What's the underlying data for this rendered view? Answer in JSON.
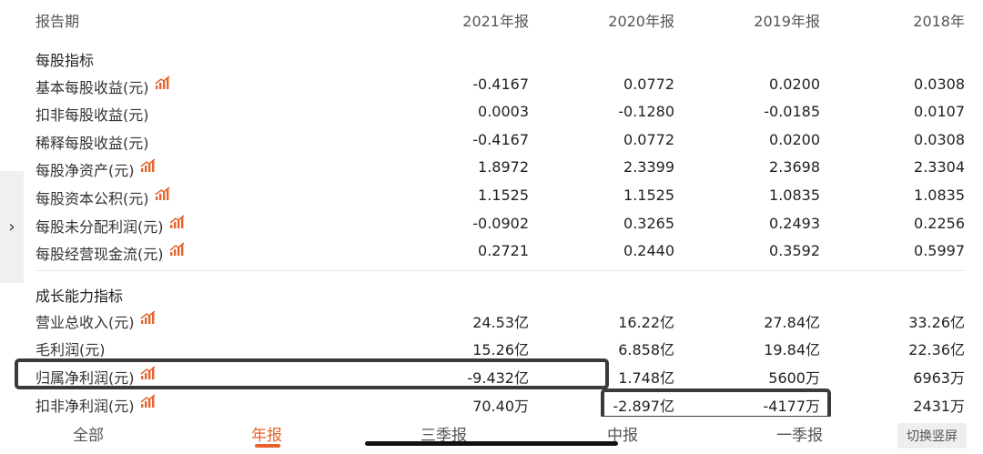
{
  "header": {
    "label": "报告期",
    "periods": [
      "2021年报",
      "2020年报",
      "2019年报",
      "2018年"
    ]
  },
  "side_tab": {
    "chevron": "›"
  },
  "sections": [
    {
      "title": "每股指标",
      "rows": [
        {
          "label": "基本每股收益(元)",
          "trend_icon": true,
          "values": [
            "-0.4167",
            "0.0772",
            "0.0200",
            "0.0308"
          ]
        },
        {
          "label": "扣非每股收益(元)",
          "trend_icon": false,
          "values": [
            "0.0003",
            "-0.1280",
            "-0.0185",
            "0.0107"
          ]
        },
        {
          "label": "稀释每股收益(元)",
          "trend_icon": false,
          "values": [
            "-0.4167",
            "0.0772",
            "0.0200",
            "0.0308"
          ]
        },
        {
          "label": "每股净资产(元)",
          "trend_icon": true,
          "values": [
            "1.8972",
            "2.3399",
            "2.3698",
            "2.3304"
          ]
        },
        {
          "label": "每股资本公积(元)",
          "trend_icon": true,
          "values": [
            "1.1525",
            "1.1525",
            "1.0835",
            "1.0835"
          ]
        },
        {
          "label": "每股未分配利润(元)",
          "trend_icon": true,
          "values": [
            "-0.0902",
            "0.3265",
            "0.2493",
            "0.2256"
          ]
        },
        {
          "label": "每股经营现金流(元)",
          "trend_icon": true,
          "values": [
            "0.2721",
            "0.2440",
            "0.3592",
            "0.5997"
          ]
        }
      ]
    },
    {
      "title": "成长能力指标",
      "rows": [
        {
          "label": "营业总收入(元)",
          "trend_icon": true,
          "values": [
            "24.53亿",
            "16.22亿",
            "27.84亿",
            "33.26亿"
          ]
        },
        {
          "label": "毛利润(元)",
          "trend_icon": false,
          "values": [
            "15.26亿",
            "6.858亿",
            "19.84亿",
            "22.36亿"
          ]
        },
        {
          "label": "归属净利润(元)",
          "trend_icon": true,
          "values": [
            "-9.432亿",
            "1.748亿",
            "5600万",
            "6963万"
          ]
        },
        {
          "label": "扣非净利润(元)",
          "trend_icon": true,
          "values": [
            "70.40万",
            "-2.897亿",
            "-4177万",
            "2431万"
          ]
        }
      ]
    }
  ],
  "bottom_nav": {
    "items": [
      "全部",
      "年报",
      "三季报",
      "中报",
      "一季报"
    ],
    "active": "年报",
    "toggle_label": "切换竖屏"
  },
  "colors": {
    "accent": "#e8642c",
    "highlight_border": "#3a3a3a"
  },
  "icons": {
    "trend": "trend-chart-icon",
    "chevron": "chevron-right-icon"
  }
}
